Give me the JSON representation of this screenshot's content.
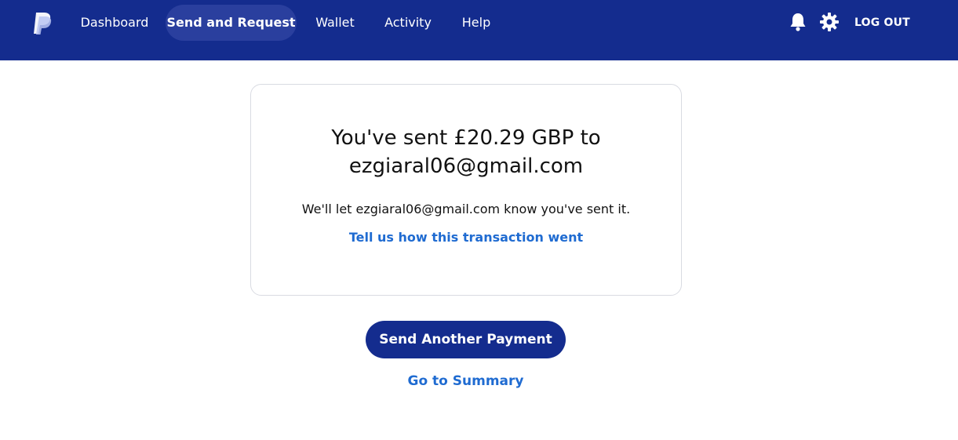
{
  "header": {
    "logo_icon": "paypal-logo-icon",
    "nav": [
      {
        "label": "Dashboard",
        "active": false
      },
      {
        "label": "Send and Request",
        "active": true
      },
      {
        "label": "Wallet",
        "active": false
      },
      {
        "label": "Activity",
        "active": false
      },
      {
        "label": "Help",
        "active": false
      }
    ],
    "notifications_icon": "bell-icon",
    "settings_icon": "gear-icon",
    "logout_label": "LOG OUT"
  },
  "confirmation": {
    "title": "You've sent £20.29 GBP to ezgiaral06@gmail.com",
    "message": "We'll let ezgiaral06@gmail.com know you've sent it.",
    "feedback_link": "Tell us how this transaction went"
  },
  "actions": {
    "send_another_label": "Send Another Payment",
    "summary_link": "Go to Summary"
  },
  "colors": {
    "header_bg": "#142c8e",
    "active_tab_bg": "#2a3f9e",
    "link": "#1f6bd1",
    "primary_button": "#142c8e"
  }
}
